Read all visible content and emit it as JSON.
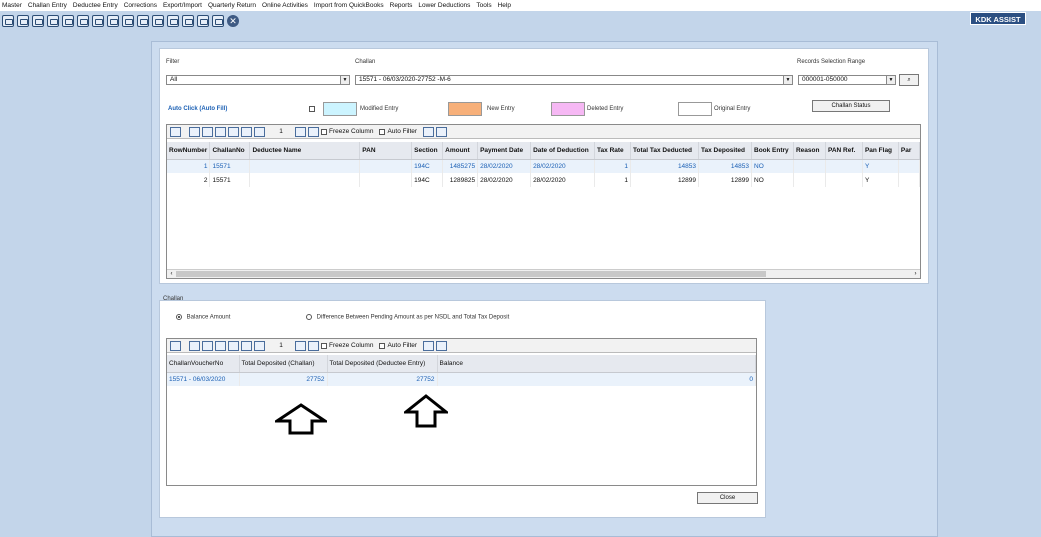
{
  "menu": [
    "Master",
    "Challan Entry",
    "Deductee Entry",
    "Corrections",
    "Export/Import",
    "Quarterly Return",
    "Online Activities",
    "Import from QuickBooks",
    "Reports",
    "Lower Deductions",
    "Tools",
    "Help"
  ],
  "brand": "KDK ASSIST",
  "filter": {
    "label": "Filter",
    "value": "All"
  },
  "challan": {
    "label": "Challan",
    "value": "15571     - 06/03/2020-27752 -M-6"
  },
  "records": {
    "label": "Records Selection Range",
    "value": "000001-050000"
  },
  "legend": {
    "auto_click": "Auto Click (Auto Fill)",
    "modified": "Modified Entry",
    "new": "New Entry",
    "deleted": "Deleted Entry",
    "original": "Original Entry",
    "colors": {
      "modified": "#ccf4ff",
      "new": "#f7b07a",
      "deleted": "#f6b8f4",
      "original": "#ffffff"
    }
  },
  "challan_status_btn": "Challan Status",
  "grid_toolbar": {
    "page": "1",
    "freeze": "Freeze Column",
    "auto_filter": "Auto Filter"
  },
  "deductee_table": {
    "columns": [
      "RowNumber",
      "ChallanNo",
      "Deductee Name",
      "PAN",
      "Section",
      "Amount",
      "Payment Date",
      "Date of Deduction",
      "Tax Rate",
      "Total Tax Deducted",
      "Tax Deposited",
      "Book Entry",
      "Reason",
      "PAN Ref.",
      "Pan Flag",
      "Par"
    ],
    "rows": [
      [
        "1",
        "15571",
        "",
        "",
        "194C",
        "1485275",
        "28/02/2020",
        "28/02/2020",
        "1",
        "14853",
        "14853",
        "NO",
        "",
        "",
        "Y",
        ""
      ],
      [
        "2",
        "15571",
        "",
        "",
        "194C",
        "1289825",
        "28/02/2020",
        "28/02/2020",
        "1",
        "12899",
        "12899",
        "NO",
        "",
        "",
        "Y",
        ""
      ]
    ]
  },
  "bottom": {
    "title": "Challan",
    "radio_balance": "Balance Amount",
    "radio_difference": "Difference Between Pending Amount as per NSDL and Total Tax Deposit",
    "columns": [
      "ChallanVoucherNo",
      "Total Deposited (Challan)",
      "Total Deposited (Deductee Entry)",
      "Balance"
    ],
    "rows": [
      [
        "15571 - 06/03/2020",
        "27752",
        "27752",
        "0"
      ]
    ],
    "close_btn": "Close"
  }
}
